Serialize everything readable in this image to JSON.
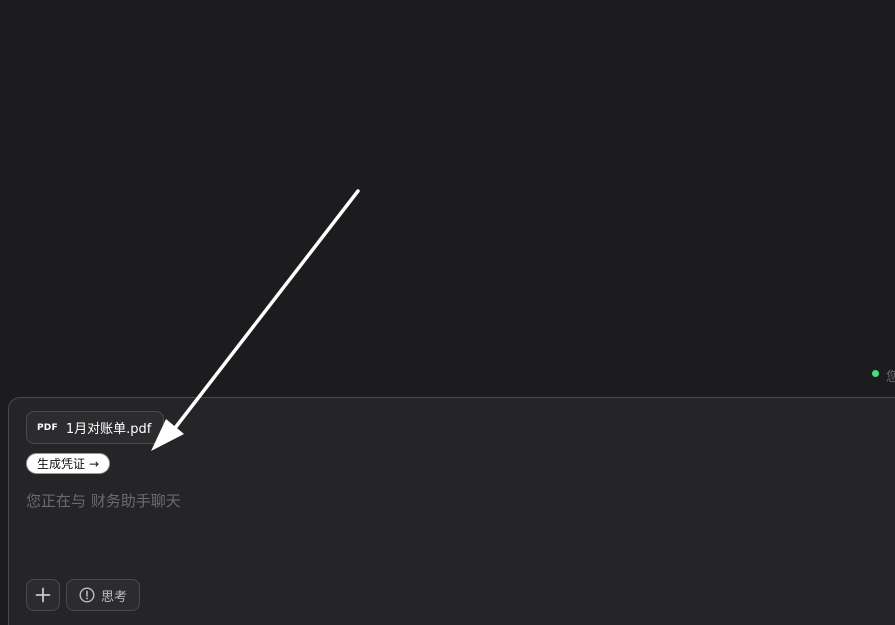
{
  "status": {
    "text": "您",
    "dot_color": "#4ade80"
  },
  "composer": {
    "attachment": {
      "type_label": "PDF",
      "file_name": "1月对账单.pdf",
      "icon": "pdf-file-icon"
    },
    "action_chip": {
      "label": "生成凭证",
      "arrow": "→"
    },
    "input": {
      "value": "",
      "placeholder": "您正在与 财务助手聊天"
    },
    "toolbar": {
      "add_icon": "plus-icon",
      "think_icon": "info-circle-icon",
      "think_label": "思考"
    }
  },
  "annotation": {
    "type": "arrow",
    "color": "#ffffff"
  },
  "colors": {
    "background": "#1c1c1e",
    "composer_bg": "#252527",
    "border": "#4a4a4e"
  }
}
